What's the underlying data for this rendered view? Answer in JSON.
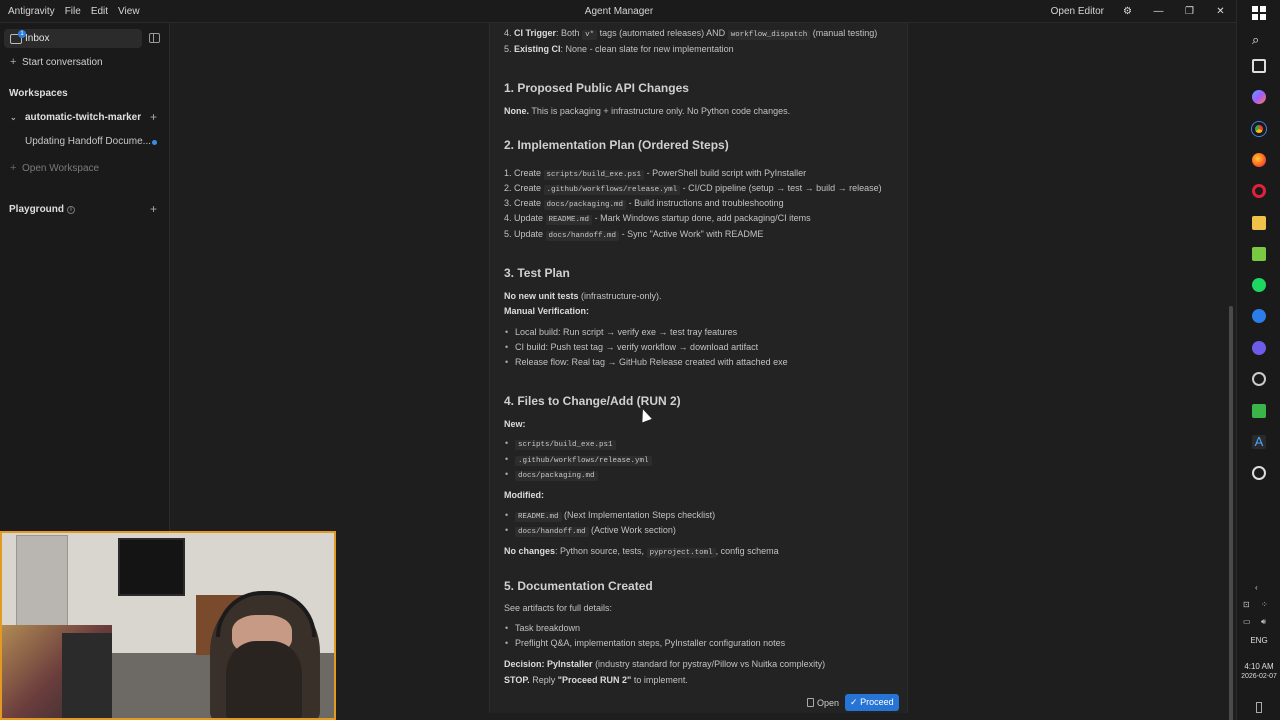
{
  "titlebar": {
    "menu": [
      "Antigravity",
      "File",
      "Edit",
      "View"
    ],
    "title": "Agent Manager",
    "open_editor": "Open Editor",
    "controls": [
      "—",
      "❐",
      "✕"
    ]
  },
  "sidebar": {
    "inbox": "Inbox",
    "inbox_badge": "1",
    "start_conversation": "Start conversation",
    "workspaces_heading": "Workspaces",
    "workspace_name": "automatic-twitch-marker",
    "conversation": "Updating Handoff Docume...",
    "open_workspace": "Open Workspace",
    "playground": "Playground"
  },
  "doc": {
    "top": {
      "ci_num": "4.",
      "ci_label": "CI Trigger",
      "ci_pre": ": Both",
      "ci_code1": "v*",
      "ci_mid": "tags (automated releases) AND",
      "ci_code2": "workflow_dispatch",
      "ci_post": "(manual testing)",
      "ex_num": "5.",
      "ex_label": "Existing CI",
      "ex_text": ": None - clean slate for new implementation"
    },
    "s1": {
      "heading": "1. Proposed Public API Changes",
      "bold": "None.",
      "text": "This is packaging + infrastructure only. No Python code changes."
    },
    "s2": {
      "heading": "2. Implementation Plan (Ordered Steps)",
      "steps": [
        {
          "pre": "1. Create",
          "code": "scripts/build_exe.ps1",
          "post": "- PowerShell build script with PyInstaller"
        },
        {
          "pre": "2. Create",
          "code": ".github/workflows/release.yml",
          "post": "- CI/CD pipeline (setup → test → build → release)"
        },
        {
          "pre": "3. Create",
          "code": "docs/packaging.md",
          "post": "- Build instructions and troubleshooting"
        },
        {
          "pre": "4. Update",
          "code": "README.md",
          "post": "- Mark Windows startup done, add packaging/CI items"
        },
        {
          "pre": "5. Update",
          "code": "docs/handoff.md",
          "post": "- Sync \"Active Work\" with README"
        }
      ]
    },
    "s3": {
      "heading": "3. Test Plan",
      "no_tests_bold": "No new unit tests",
      "no_tests_text": "(infrastructure-only).",
      "manual_label": "Manual Verification:",
      "items": [
        "Local build: Run script → verify exe → test tray features",
        "CI build: Push test tag → verify workflow → download artifact",
        "Release flow: Real tag → GitHub Release created with attached exe"
      ]
    },
    "s4": {
      "heading": "4. Files to Change/Add (RUN 2)",
      "new_label": "New:",
      "new_files": [
        "scripts/build_exe.ps1",
        ".github/workflows/release.yml",
        "docs/packaging.md"
      ],
      "modified_label": "Modified:",
      "modified": [
        {
          "code": "README.md",
          "text": "(Next Implementation Steps checklist)"
        },
        {
          "code": "docs/handoff.md",
          "text": "(Active Work section)"
        }
      ],
      "no_changes_bold": "No changes",
      "no_changes_pre": ": Python source, tests,",
      "no_changes_code": "pyproject.toml",
      "no_changes_post": ", config schema"
    },
    "s5": {
      "heading": "5. Documentation Created",
      "intro": "See artifacts for full details:",
      "items": [
        "Task breakdown",
        "Preflight Q&A, implementation steps, PyInstaller configuration notes"
      ],
      "decision_bold": "Decision: PyInstaller",
      "decision_text": "(industry standard for pystray/Pillow vs Nuitka complexity)",
      "stop_bold": "STOP.",
      "stop_pre": "Reply",
      "stop_quote": "\"Proceed RUN 2\"",
      "stop_post": "to implement."
    },
    "buttons": {
      "open": "Open",
      "proceed": "Proceed"
    }
  },
  "taskbar": {
    "language": "ENG",
    "time": "4:10 AM",
    "date": "2026-02-07"
  },
  "colors": {
    "accent": "#2675d6",
    "webcam_border": "#e39a22",
    "background": "#1e1e1e"
  }
}
